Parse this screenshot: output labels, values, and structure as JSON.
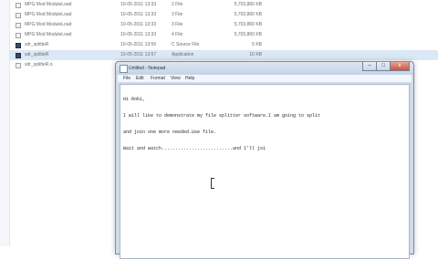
{
  "explorer": {
    "files": [
      {
        "name": "MPG Mod ModuleLoad",
        "date": "10-05-2011 13:33",
        "type": "2 File",
        "size": "5,703,860 KB",
        "icon": "document-icon"
      },
      {
        "name": "MPG Mod ModuleLoad",
        "date": "10-05-2011 13:33",
        "type": "3 File",
        "size": "5,703,860 KB",
        "icon": "document-icon"
      },
      {
        "name": "MPG Mod ModuleLoad",
        "date": "10-05-2011 13:33",
        "type": "3 File",
        "size": "5,703,860 KB",
        "icon": "document-icon"
      },
      {
        "name": "MPG Mod ModuleLoad",
        "date": "10-05-2011 13:33",
        "type": "4 File",
        "size": "5,703,860 KB",
        "icon": "document-icon"
      },
      {
        "name": "sdr_splitteR",
        "date": "10-05-2011 13:56",
        "type": "C Source File",
        "size": "6 KB",
        "icon": "executable-icon"
      },
      {
        "name": "sdr_splitteR",
        "date": "10-05-2011 13:57",
        "type": "Application",
        "size": "10 KB",
        "icon": "executable-icon"
      },
      {
        "name": "sdr_splitteR.o",
        "date": "",
        "type": "",
        "size": "",
        "icon": "document-icon"
      }
    ]
  },
  "notepad": {
    "title": "Untitled - Notepad",
    "controls": {
      "minimize": "–",
      "maximize": "□",
      "close": "x"
    },
    "menu": {
      "file": "File",
      "edit": "Edit",
      "format": "Format",
      "view": "View",
      "help": "Help"
    },
    "lines": [
      "Hi Robi,",
      "I will like to demonstrate my file splitter software.I am going to split",
      "and join one more needed.Use file.",
      "Wait and watch..........................and I'll joi"
    ]
  }
}
